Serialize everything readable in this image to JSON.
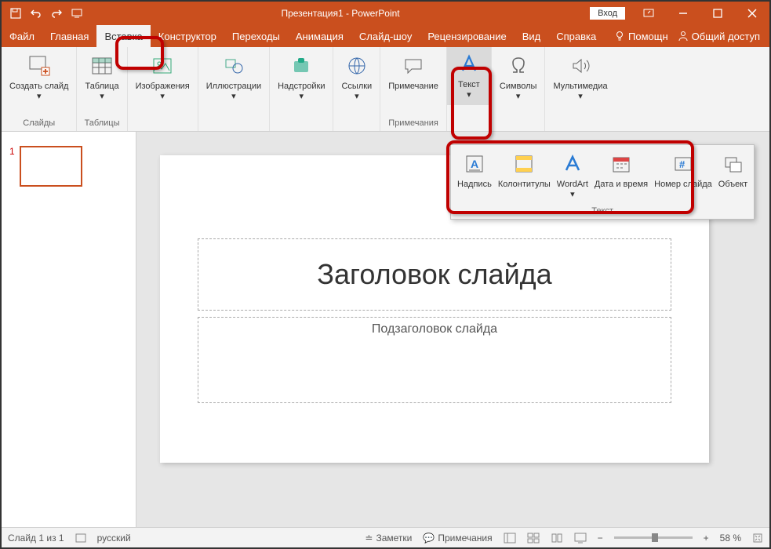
{
  "window": {
    "title": "Презентация1 - PowerPoint",
    "login": "Вход"
  },
  "tabs": {
    "file": "Файл",
    "home": "Главная",
    "insert": "Вставка",
    "design": "Конструктор",
    "transitions": "Переходы",
    "animations": "Анимация",
    "slideshow": "Слайд-шоу",
    "review": "Рецензирование",
    "view": "Вид",
    "help": "Справка",
    "tellme": "Помощн",
    "share": "Общий доступ"
  },
  "ribbon": {
    "newSlide": "Создать слайд",
    "slidesGroup": "Слайды",
    "table": "Таблица",
    "tablesGroup": "Таблицы",
    "images": "Изображения",
    "illustrations": "Иллюстрации",
    "addins": "Надстройки",
    "links": "Ссылки",
    "comment": "Примечание",
    "commentsGroup": "Примечания",
    "text": "Текст",
    "symbols": "Символы",
    "media": "Мультимедиа"
  },
  "textPopup": {
    "textbox": "Надпись",
    "headerfooter": "Колонтитулы",
    "wordart": "WordArt",
    "datetime": "Дата и время",
    "slidenumber": "Номер слайда",
    "object": "Объект",
    "group": "Текст"
  },
  "slide": {
    "title": "Заголовок слайда",
    "subtitle": "Подзаголовок слайда"
  },
  "statusbar": {
    "slideinfo": "Слайд 1 из 1",
    "lang": "русский",
    "notes": "Заметки",
    "comments": "Примечания",
    "zoom": "58 %"
  },
  "thumbs": {
    "num1": "1"
  }
}
